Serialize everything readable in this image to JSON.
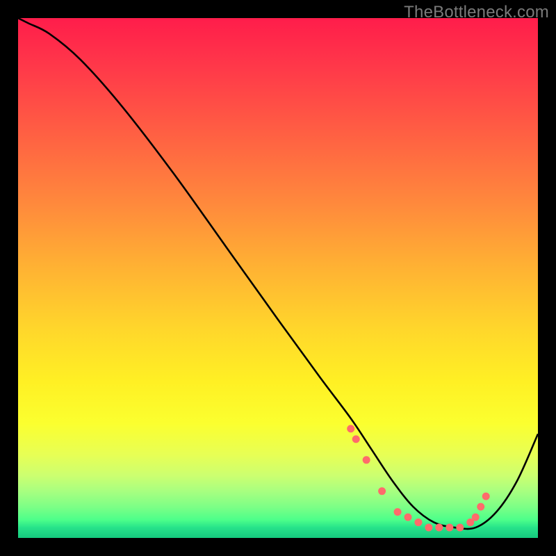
{
  "watermark": "TheBottleneck.com",
  "chart_data": {
    "type": "line",
    "title": "",
    "xlabel": "",
    "ylabel": "",
    "xlim": [
      0,
      100
    ],
    "ylim": [
      0,
      100
    ],
    "series": [
      {
        "name": "curve",
        "x": [
          0,
          2,
          6,
          12,
          20,
          30,
          40,
          50,
          58,
          64,
          68,
          72,
          76,
          80,
          84,
          88,
          92,
          96,
          100
        ],
        "y": [
          100,
          99,
          97,
          92,
          83,
          70,
          56,
          42,
          31,
          23,
          17,
          11,
          6,
          3,
          2,
          2,
          5,
          11,
          20
        ]
      }
    ],
    "markers": {
      "name": "highlight-points",
      "color": "#ff6b6b",
      "x": [
        64,
        65,
        67,
        70,
        73,
        75,
        77,
        79,
        81,
        83,
        85,
        87,
        88,
        89,
        90
      ],
      "y": [
        21,
        19,
        15,
        9,
        5,
        4,
        3,
        2,
        2,
        2,
        2,
        3,
        4,
        6,
        8
      ]
    }
  }
}
